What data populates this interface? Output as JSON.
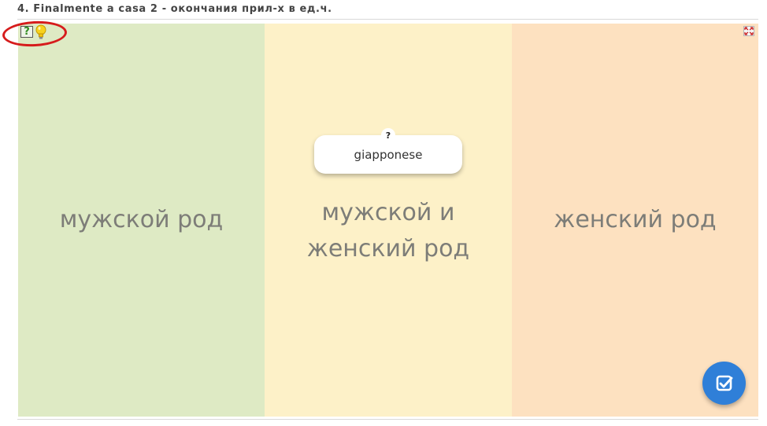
{
  "header": {
    "title": "4. Finalmente a casa 2 - окончания прил-х в ед.ч."
  },
  "columns": [
    {
      "label": "мужской род",
      "color": "#deeac4"
    },
    {
      "label_line1": "мужской и",
      "label_line2": "женский род",
      "color": "#fdf1c8"
    },
    {
      "label": "женский род",
      "color": "#fde1c0"
    }
  ],
  "card": {
    "word": "giapponese",
    "help": "?"
  },
  "toolbar": {
    "help_glyph": "?"
  },
  "icons": {
    "help": "help-question-icon",
    "hint": "lightbulb-icon",
    "fullscreen": "fullscreen-icon",
    "check": "checkmark-icon"
  },
  "annotation": {
    "color": "#d61c1c"
  },
  "accent": "#2f7fd8"
}
